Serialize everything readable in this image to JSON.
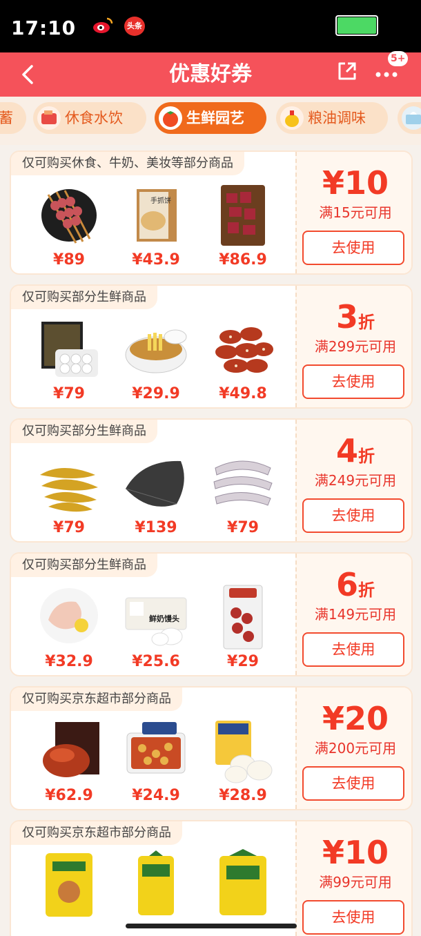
{
  "status": {
    "time": "17:10",
    "toutiao_label": "头条"
  },
  "header": {
    "title": "优惠好券",
    "badge": "5+"
  },
  "tabs": [
    {
      "label": "蓄"
    },
    {
      "label": "休食水饮"
    },
    {
      "label": "生鲜园艺"
    },
    {
      "label": "粮油调味"
    },
    {
      "label": ""
    }
  ],
  "coupons": [
    {
      "tagline": "仅可购买休食、牛奶、美妆等部分商品",
      "amount": "¥10",
      "condition": "满15元可用",
      "button": "去使用",
      "products": [
        {
          "price": "¥89",
          "icon": "lamb-skewers"
        },
        {
          "price": "¥43.9",
          "icon": "hand-pancake-box"
        },
        {
          "price": "¥86.9",
          "icon": "beef-cubes"
        }
      ]
    },
    {
      "tagline": "仅可购买部分生鲜商品",
      "amount": "3折",
      "condition": "满299元可用",
      "button": "去使用",
      "products": [
        {
          "price": "¥79",
          "icon": "dumplings-box"
        },
        {
          "price": "¥29.9",
          "icon": "soup-pot"
        },
        {
          "price": "¥49.8",
          "icon": "sausages"
        }
      ]
    },
    {
      "tagline": "仅可购买部分生鲜商品",
      "amount": "4折",
      "condition": "满249元可用",
      "button": "去使用",
      "products": [
        {
          "price": "¥79",
          "icon": "yellow-croaker"
        },
        {
          "price": "¥139",
          "icon": "flatfish"
        },
        {
          "price": "¥79",
          "icon": "squid"
        }
      ]
    },
    {
      "tagline": "仅可购买部分生鲜商品",
      "amount": "6折",
      "condition": "满149元可用",
      "button": "去使用",
      "products": [
        {
          "price": "¥32.9",
          "icon": "chicken-breast"
        },
        {
          "price": "¥25.6",
          "icon": "milk-buns"
        },
        {
          "price": "¥29",
          "icon": "salami-pack"
        }
      ]
    },
    {
      "tagline": "仅可购买京东超市部分商品",
      "amount": "¥20",
      "condition": "满200元可用",
      "button": "去使用",
      "products": [
        {
          "price": "¥62.9",
          "icon": "roast-duck"
        },
        {
          "price": "¥24.9",
          "icon": "hotpot-box"
        },
        {
          "price": "¥28.9",
          "icon": "steamed-buns"
        }
      ]
    },
    {
      "tagline": "仅可购买京东超市部分商品",
      "amount": "¥10",
      "condition": "满99元可用",
      "button": "去使用",
      "products": [
        {
          "price": "",
          "icon": "flour-bag"
        },
        {
          "price": "",
          "icon": "rice-bag-small"
        },
        {
          "price": "",
          "icon": "rice-bag"
        }
      ]
    }
  ]
}
